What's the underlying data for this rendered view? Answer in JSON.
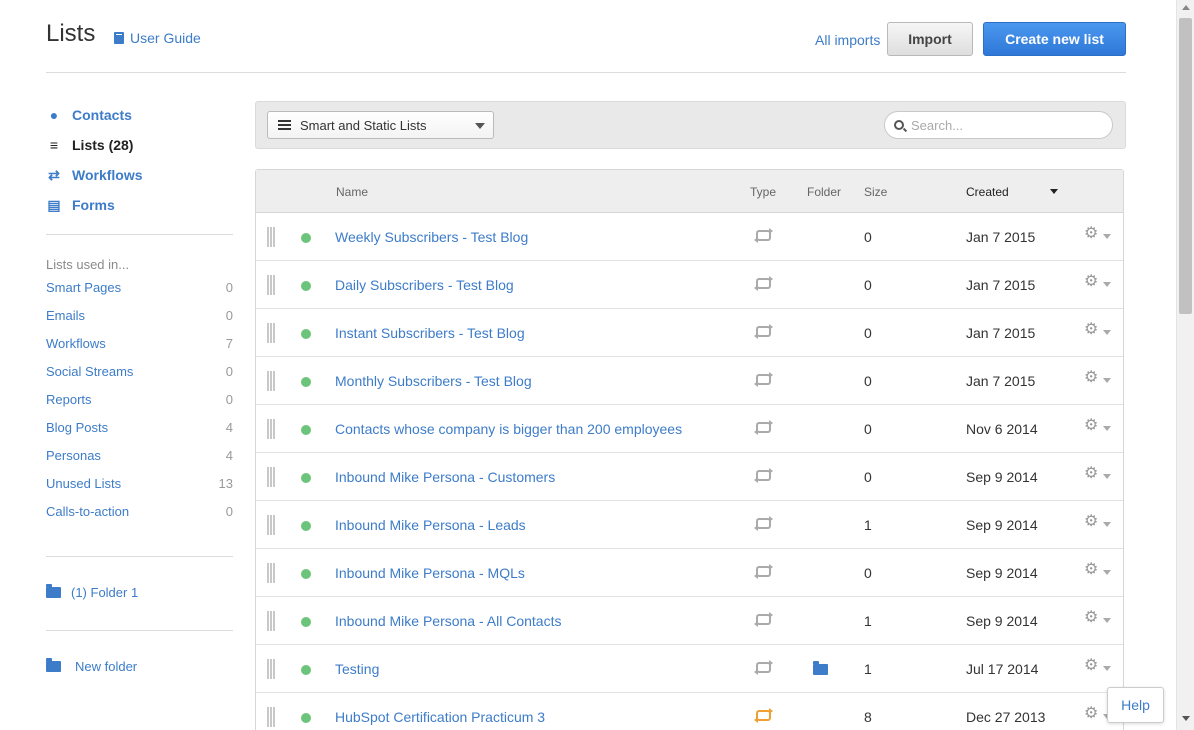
{
  "header": {
    "title": "Lists",
    "user_guide": "User Guide",
    "all_imports": "All imports",
    "import_label": "Import",
    "create_label": "Create new list"
  },
  "sidebar": {
    "nav": [
      {
        "label": "Contacts",
        "icon": "person-icon"
      },
      {
        "label": "Lists (28)",
        "icon": "list-icon",
        "active": true
      },
      {
        "label": "Workflows",
        "icon": "shuffle-icon"
      },
      {
        "label": "Forms",
        "icon": "form-icon"
      }
    ],
    "used_heading": "Lists used in...",
    "used": [
      {
        "label": "Smart Pages",
        "count": "0"
      },
      {
        "label": "Emails",
        "count": "0"
      },
      {
        "label": "Workflows",
        "count": "7"
      },
      {
        "label": "Social Streams",
        "count": "0"
      },
      {
        "label": "Reports",
        "count": "0"
      },
      {
        "label": "Blog Posts",
        "count": "4"
      },
      {
        "label": "Personas",
        "count": "4"
      },
      {
        "label": "Unused Lists",
        "count": "13"
      },
      {
        "label": "Calls-to-action",
        "count": "0"
      }
    ],
    "folder": "(1) Folder 1",
    "new_folder": "New folder"
  },
  "filter": {
    "selected": "Smart and Static Lists",
    "search_placeholder": "Search..."
  },
  "table": {
    "headers": {
      "name": "Name",
      "type": "Type",
      "folder": "Folder",
      "size": "Size",
      "created": "Created"
    },
    "rows": [
      {
        "name": "Weekly Subscribers - Test Blog",
        "size": "0",
        "created": "Jan 7 2015",
        "type": "static",
        "in_folder": false
      },
      {
        "name": "Daily Subscribers - Test Blog",
        "size": "0",
        "created": "Jan 7 2015",
        "type": "static",
        "in_folder": false
      },
      {
        "name": "Instant Subscribers - Test Blog",
        "size": "0",
        "created": "Jan 7 2015",
        "type": "static",
        "in_folder": false
      },
      {
        "name": "Monthly Subscribers - Test Blog",
        "size": "0",
        "created": "Jan 7 2015",
        "type": "static",
        "in_folder": false
      },
      {
        "name": "Contacts whose company is bigger than 200 employees",
        "size": "0",
        "created": "Nov 6 2014",
        "type": "static",
        "in_folder": false
      },
      {
        "name": "Inbound Mike Persona - Customers",
        "size": "0",
        "created": "Sep 9 2014",
        "type": "static",
        "in_folder": false
      },
      {
        "name": "Inbound Mike Persona - Leads",
        "size": "1",
        "created": "Sep 9 2014",
        "type": "static",
        "in_folder": false
      },
      {
        "name": "Inbound Mike Persona - MQLs",
        "size": "0",
        "created": "Sep 9 2014",
        "type": "static",
        "in_folder": false
      },
      {
        "name": "Inbound Mike Persona - All Contacts",
        "size": "1",
        "created": "Sep 9 2014",
        "type": "static",
        "in_folder": false
      },
      {
        "name": "Testing",
        "size": "1",
        "created": "Jul 17 2014",
        "type": "static",
        "in_folder": true
      },
      {
        "name": "HubSpot Certification Practicum 3",
        "size": "8",
        "created": "Dec 27 2013",
        "type": "smart",
        "in_folder": false
      }
    ]
  },
  "help_label": "Help",
  "colors": {
    "link": "#3d7cc9",
    "primary": "#2f78d8",
    "active_dot": "#6cc37a",
    "smart_icon": "#f0a033"
  }
}
